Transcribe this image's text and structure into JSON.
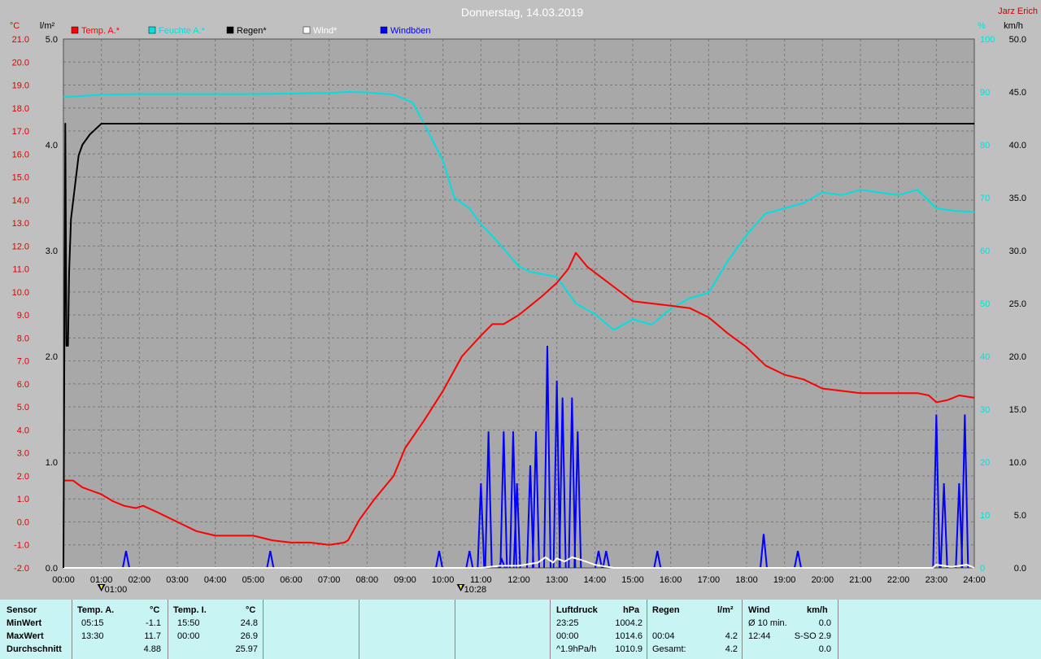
{
  "chart_data": {
    "type": "line",
    "title": "Donnerstag, 14.03.2019",
    "station_label": "Jarz Erich",
    "legend": [
      {
        "label": "Temp. A.*",
        "color": "#ff0000"
      },
      {
        "label": "Feuchte A.*",
        "color": "#00e0e0"
      },
      {
        "label": "Regen*",
        "color": "#000000"
      },
      {
        "label": "Wind*",
        "color": "#ffffff"
      },
      {
        "label": "Windböen",
        "color": "#0000ff"
      }
    ],
    "axes": {
      "temp": {
        "unit": "°C",
        "min": -2.0,
        "max": 21.0,
        "ticks": [
          "-2.0",
          "-1.0",
          "0.0",
          "1.0",
          "2.0",
          "3.0",
          "4.0",
          "5.0",
          "6.0",
          "7.0",
          "8.0",
          "9.0",
          "10.0",
          "11.0",
          "12.0",
          "13.0",
          "14.0",
          "15.0",
          "16.0",
          "17.0",
          "18.0",
          "19.0",
          "20.0",
          "21.0"
        ]
      },
      "rain": {
        "unit": "l/m²",
        "min": 0.0,
        "max": 5.0,
        "ticks": [
          "0.0",
          "1.0",
          "2.0",
          "3.0",
          "4.0",
          "5.0"
        ]
      },
      "humidity": {
        "unit": "%",
        "min": 0,
        "max": 100,
        "ticks": [
          "0",
          "10",
          "20",
          "30",
          "40",
          "50",
          "60",
          "70",
          "80",
          "90",
          "100"
        ]
      },
      "wind": {
        "unit": "km/h",
        "min": 0.0,
        "max": 50.0,
        "ticks": [
          "0.0",
          "5.0",
          "10.0",
          "15.0",
          "20.0",
          "25.0",
          "30.0",
          "35.0",
          "40.0",
          "45.0",
          "50.0"
        ]
      },
      "time": {
        "ticks": [
          "00:00",
          "01:00",
          "02:00",
          "03:00",
          "04:00",
          "05:00",
          "06:00",
          "07:00",
          "08:00",
          "09:00",
          "10:00",
          "11:00",
          "12:00",
          "13:00",
          "14:00",
          "15:00",
          "16:00",
          "17:00",
          "18:00",
          "19:00",
          "20:00",
          "21:00",
          "22:00",
          "23:00",
          "24:00"
        ]
      }
    },
    "markers": [
      {
        "time": 1.0,
        "label": "01:00"
      },
      {
        "time": 10.47,
        "label": "10:28"
      }
    ],
    "series": [
      {
        "name": "Temp. A.*",
        "axis": "temp",
        "color": "#ff0000",
        "points": [
          [
            0,
            1.8
          ],
          [
            0.25,
            1.8
          ],
          [
            0.5,
            1.5
          ],
          [
            1,
            1.2
          ],
          [
            1.3,
            0.9
          ],
          [
            1.6,
            0.7
          ],
          [
            1.9,
            0.6
          ],
          [
            2.1,
            0.7
          ],
          [
            2.5,
            0.4
          ],
          [
            3,
            0.0
          ],
          [
            3.5,
            -0.4
          ],
          [
            4,
            -0.6
          ],
          [
            4.5,
            -0.6
          ],
          [
            5,
            -0.6
          ],
          [
            5.5,
            -0.8
          ],
          [
            6,
            -0.9
          ],
          [
            6.5,
            -0.9
          ],
          [
            7,
            -1.0
          ],
          [
            7.4,
            -0.9
          ],
          [
            7.5,
            -0.8
          ],
          [
            7.8,
            0.1
          ],
          [
            8.2,
            1.0
          ],
          [
            8.7,
            2.0
          ],
          [
            9,
            3.2
          ],
          [
            9.5,
            4.4
          ],
          [
            10,
            5.7
          ],
          [
            10.5,
            7.2
          ],
          [
            11,
            8.1
          ],
          [
            11.3,
            8.6
          ],
          [
            11.6,
            8.6
          ],
          [
            12,
            9.0
          ],
          [
            12.3,
            9.4
          ],
          [
            12.6,
            9.8
          ],
          [
            13,
            10.4
          ],
          [
            13.3,
            11.0
          ],
          [
            13.5,
            11.7
          ],
          [
            13.8,
            11.1
          ],
          [
            14.2,
            10.6
          ],
          [
            14.6,
            10.1
          ],
          [
            15,
            9.6
          ],
          [
            15.5,
            9.5
          ],
          [
            16,
            9.4
          ],
          [
            16.5,
            9.3
          ],
          [
            17,
            8.9
          ],
          [
            17.5,
            8.2
          ],
          [
            18,
            7.6
          ],
          [
            18.5,
            6.8
          ],
          [
            19,
            6.4
          ],
          [
            19.5,
            6.2
          ],
          [
            20,
            5.8
          ],
          [
            20.5,
            5.7
          ],
          [
            21,
            5.6
          ],
          [
            21.5,
            5.6
          ],
          [
            22,
            5.6
          ],
          [
            22.5,
            5.6
          ],
          [
            22.8,
            5.5
          ],
          [
            23,
            5.2
          ],
          [
            23.3,
            5.3
          ],
          [
            23.6,
            5.5
          ],
          [
            24,
            5.4
          ]
        ]
      },
      {
        "name": "Feuchte A.*",
        "axis": "humidity",
        "color": "#00e0e0",
        "points": [
          [
            0,
            89
          ],
          [
            1,
            89.5
          ],
          [
            2,
            89.6
          ],
          [
            5,
            89.6
          ],
          [
            7,
            89.8
          ],
          [
            7.5,
            90
          ],
          [
            8,
            89.9
          ],
          [
            8.7,
            89.5
          ],
          [
            9.2,
            88
          ],
          [
            9.5,
            84
          ],
          [
            10,
            77
          ],
          [
            10.3,
            70
          ],
          [
            10.7,
            68
          ],
          [
            11,
            65
          ],
          [
            11.4,
            62
          ],
          [
            12,
            57
          ],
          [
            12.3,
            56
          ],
          [
            13,
            55
          ],
          [
            13.5,
            50
          ],
          [
            14,
            48
          ],
          [
            14.5,
            45
          ],
          [
            15,
            47
          ],
          [
            15.5,
            46
          ],
          [
            16,
            49
          ],
          [
            16.5,
            51
          ],
          [
            17,
            52
          ],
          [
            17.5,
            58
          ],
          [
            18,
            63
          ],
          [
            18.5,
            67
          ],
          [
            19,
            68
          ],
          [
            19.5,
            69
          ],
          [
            20,
            71
          ],
          [
            20.5,
            70.5
          ],
          [
            21,
            71.5
          ],
          [
            21.5,
            71
          ],
          [
            22,
            70.5
          ],
          [
            22.5,
            71.5
          ],
          [
            23,
            68
          ],
          [
            23.5,
            67.5
          ],
          [
            24,
            67.3
          ]
        ]
      },
      {
        "name": "Regen*",
        "axis": "rain",
        "color": "#000000",
        "points": [
          [
            0,
            0
          ],
          [
            0.05,
            4.2
          ],
          [
            0.08,
            2.1
          ],
          [
            0.12,
            2.1
          ],
          [
            0.15,
            2.8
          ],
          [
            0.2,
            3.3
          ],
          [
            0.3,
            3.6
          ],
          [
            0.4,
            3.9
          ],
          [
            0.5,
            4.0
          ],
          [
            0.7,
            4.1
          ],
          [
            1,
            4.2
          ],
          [
            1.5,
            4.2
          ],
          [
            2,
            4.2
          ],
          [
            24,
            4.2
          ]
        ]
      },
      {
        "name": "Wind*",
        "axis": "wind",
        "color": "#ffffff",
        "points": [
          [
            0,
            0
          ],
          [
            11,
            0
          ],
          [
            11.5,
            0.2
          ],
          [
            12,
            0.2
          ],
          [
            12.5,
            0.5
          ],
          [
            12.7,
            1.0
          ],
          [
            12.9,
            0.5
          ],
          [
            13,
            0.9
          ],
          [
            13.2,
            0.6
          ],
          [
            13.4,
            1.0
          ],
          [
            13.6,
            0.8
          ],
          [
            14,
            0.3
          ],
          [
            14.5,
            0
          ],
          [
            22.9,
            0
          ],
          [
            23,
            0.3
          ],
          [
            23.4,
            0.1
          ],
          [
            23.8,
            0.3
          ],
          [
            24,
            0
          ]
        ]
      },
      {
        "name": "Windböen",
        "axis": "wind",
        "color": "#0000ff",
        "spikes": [
          [
            1.65,
            1.6
          ],
          [
            5.45,
            1.6
          ],
          [
            9.9,
            1.6
          ],
          [
            10.7,
            1.6
          ],
          [
            11.0,
            8.0
          ],
          [
            11.2,
            12.9
          ],
          [
            11.55,
            0.8
          ],
          [
            11.6,
            12.9
          ],
          [
            11.85,
            12.9
          ],
          [
            11.95,
            8.0
          ],
          [
            12.3,
            9.7
          ],
          [
            12.45,
            12.9
          ],
          [
            12.75,
            21.0
          ],
          [
            13.0,
            17.7
          ],
          [
            13.15,
            16.1
          ],
          [
            13.4,
            16.1
          ],
          [
            13.55,
            12.9
          ],
          [
            14.1,
            1.6
          ],
          [
            14.3,
            1.6
          ],
          [
            15.65,
            1.6
          ],
          [
            18.45,
            3.2
          ],
          [
            19.35,
            1.6
          ],
          [
            23.0,
            14.5
          ],
          [
            23.2,
            8.0
          ],
          [
            23.6,
            8.0
          ],
          [
            23.75,
            14.5
          ]
        ]
      }
    ]
  },
  "summary": {
    "headers": {
      "sensor": "Sensor",
      "temp_a": "Temp. A.",
      "temp_a_unit": "°C",
      "temp_i": "Temp. I.",
      "temp_i_unit": "°C",
      "pressure": "Luftdruck",
      "pressure_unit": "hPa",
      "rain": "Regen",
      "rain_unit": "l/m²",
      "wind": "Wind",
      "wind_unit": "km/h"
    },
    "rows": [
      {
        "label": "MinWert",
        "ta_time": "05:15",
        "ta_val": "-1.1",
        "ti_time": "15:50",
        "ti_val": "24.8",
        "p_time": "23:25",
        "p_val": "1004.2",
        "r_time": "",
        "r_val": "",
        "w_time": "Ø 10 min.",
        "w_val": "0.0"
      },
      {
        "label": "MaxWert",
        "ta_time": "13:30",
        "ta_val": "11.7",
        "ti_time": "00:00",
        "ti_val": "26.9",
        "p_time": "00:00",
        "p_val": "1014.6",
        "r_time": "00:04",
        "r_val": "4.2",
        "w_time": "12:44",
        "w_val": "S-SO 2.9"
      },
      {
        "label": "Durchschnitt",
        "ta_time": "",
        "ta_val": "4.88",
        "ti_time": "",
        "ti_val": "25.97",
        "p_time": "^1.9hPa/h",
        "p_val": "1010.9",
        "r_time": "Gesamt:",
        "r_val": "4.2",
        "w_time": "",
        "w_val": "0.0"
      }
    ]
  }
}
